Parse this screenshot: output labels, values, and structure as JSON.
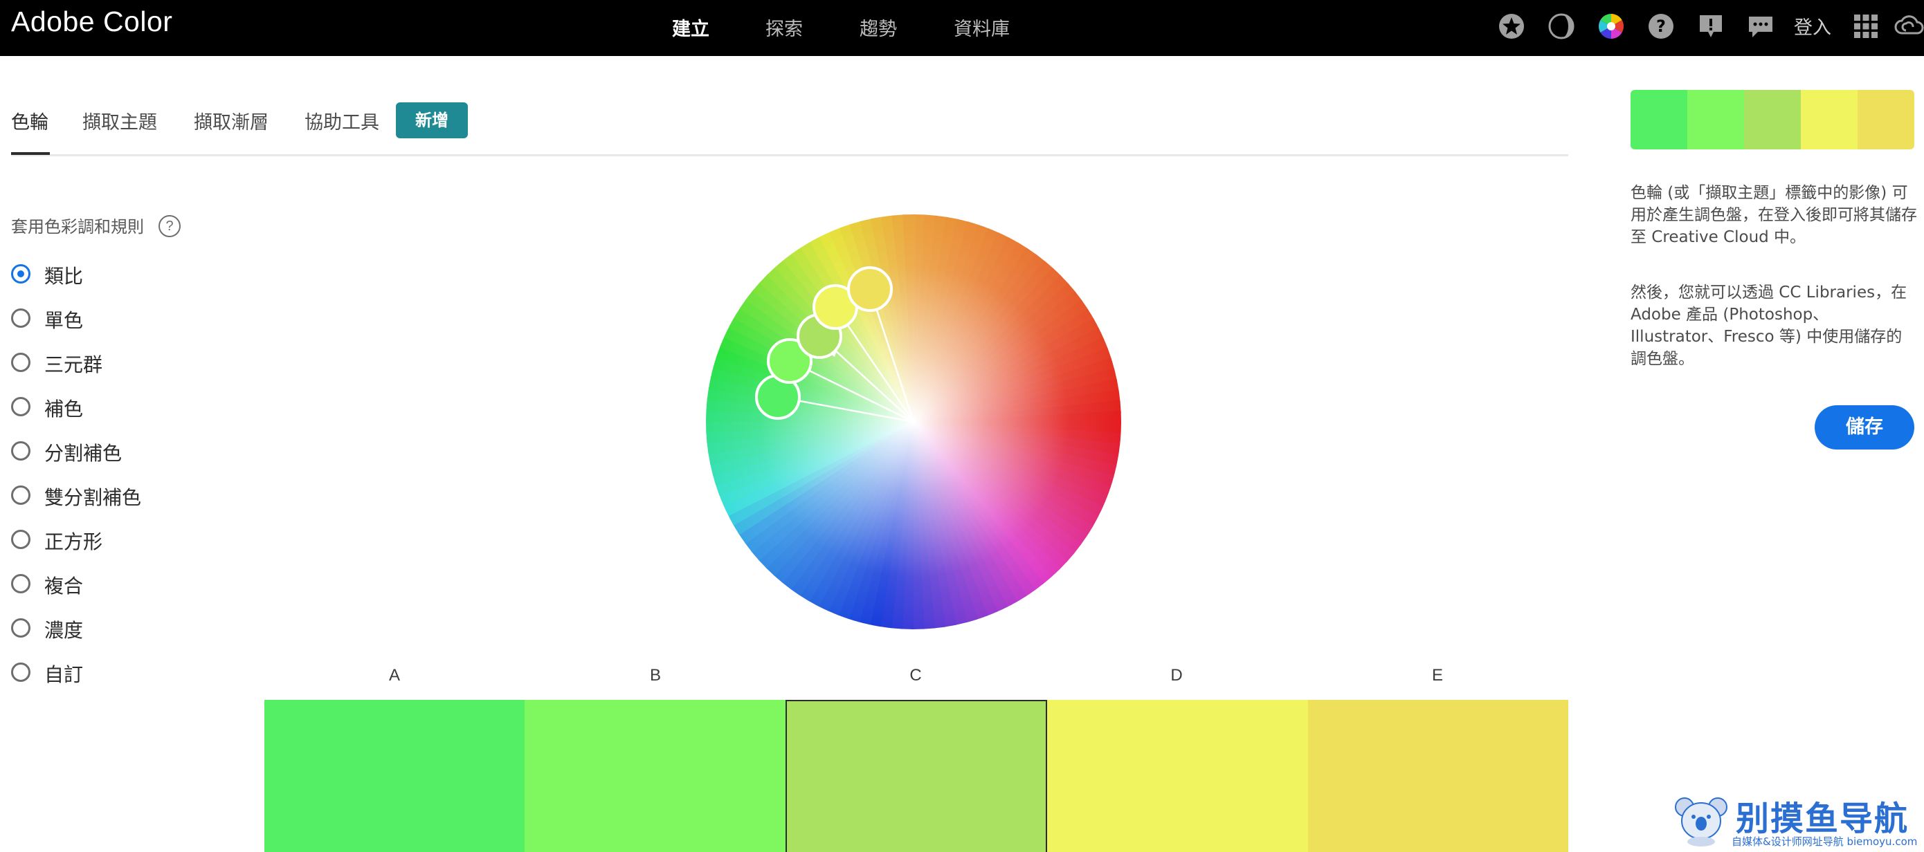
{
  "app": {
    "brand": "Adobe Color",
    "nav": [
      {
        "label": "建立",
        "active": true
      },
      {
        "label": "探索",
        "active": false
      },
      {
        "label": "趨勢",
        "active": false
      },
      {
        "label": "資料庫",
        "active": false
      }
    ],
    "login_label": "登入",
    "icons": [
      "star-icon",
      "contrast-icon",
      "color-wheel-icon",
      "help-icon",
      "feedback-icon",
      "chat-icon",
      "apps-grid-icon",
      "creative-cloud-icon"
    ]
  },
  "tabs": [
    {
      "label": "色輪",
      "active": true
    },
    {
      "label": "擷取主題",
      "active": false
    },
    {
      "label": "擷取漸層",
      "active": false
    },
    {
      "label": "協助工具",
      "active": false
    }
  ],
  "new_badge": "新增",
  "rules": {
    "title": "套用色彩調和規則",
    "help_glyph": "?",
    "options": [
      {
        "label": "類比",
        "selected": true
      },
      {
        "label": "單色",
        "selected": false
      },
      {
        "label": "三元群",
        "selected": false
      },
      {
        "label": "補色",
        "selected": false
      },
      {
        "label": "分割補色",
        "selected": false
      },
      {
        "label": "雙分割補色",
        "selected": false
      },
      {
        "label": "正方形",
        "selected": false
      },
      {
        "label": "複合",
        "selected": false
      },
      {
        "label": "濃度",
        "selected": false
      },
      {
        "label": "自訂",
        "selected": false
      }
    ]
  },
  "swatches": [
    {
      "label": "A",
      "color": "#55ef66",
      "selected": false
    },
    {
      "label": "B",
      "color": "#7ef85e",
      "selected": false
    },
    {
      "label": "C",
      "color": "#abe160",
      "selected": true
    },
    {
      "label": "D",
      "color": "#f0f45f",
      "selected": false
    },
    {
      "label": "E",
      "color": "#efe05c",
      "selected": false
    }
  ],
  "right_panel": {
    "info1": "色輪 (或「擷取主題」標籤中的影像) 可用於產生調色盤，在登入後即可將其儲存至 Creative Cloud 中。",
    "info2": "然後，您就可以透過 CC Libraries，在 Adobe 產品 (Photoshop、Illustrator、Fresco 等) 中使用儲存的調色盤。",
    "save_label": "儲存"
  },
  "watermark": {
    "title": "别摸鱼导航",
    "subtitle": "自媒体&设计师网址导航 biemoyu.com"
  },
  "colors": {
    "accent": "#1473e6",
    "badge": "#1f8a93",
    "topbar": "#000000"
  }
}
